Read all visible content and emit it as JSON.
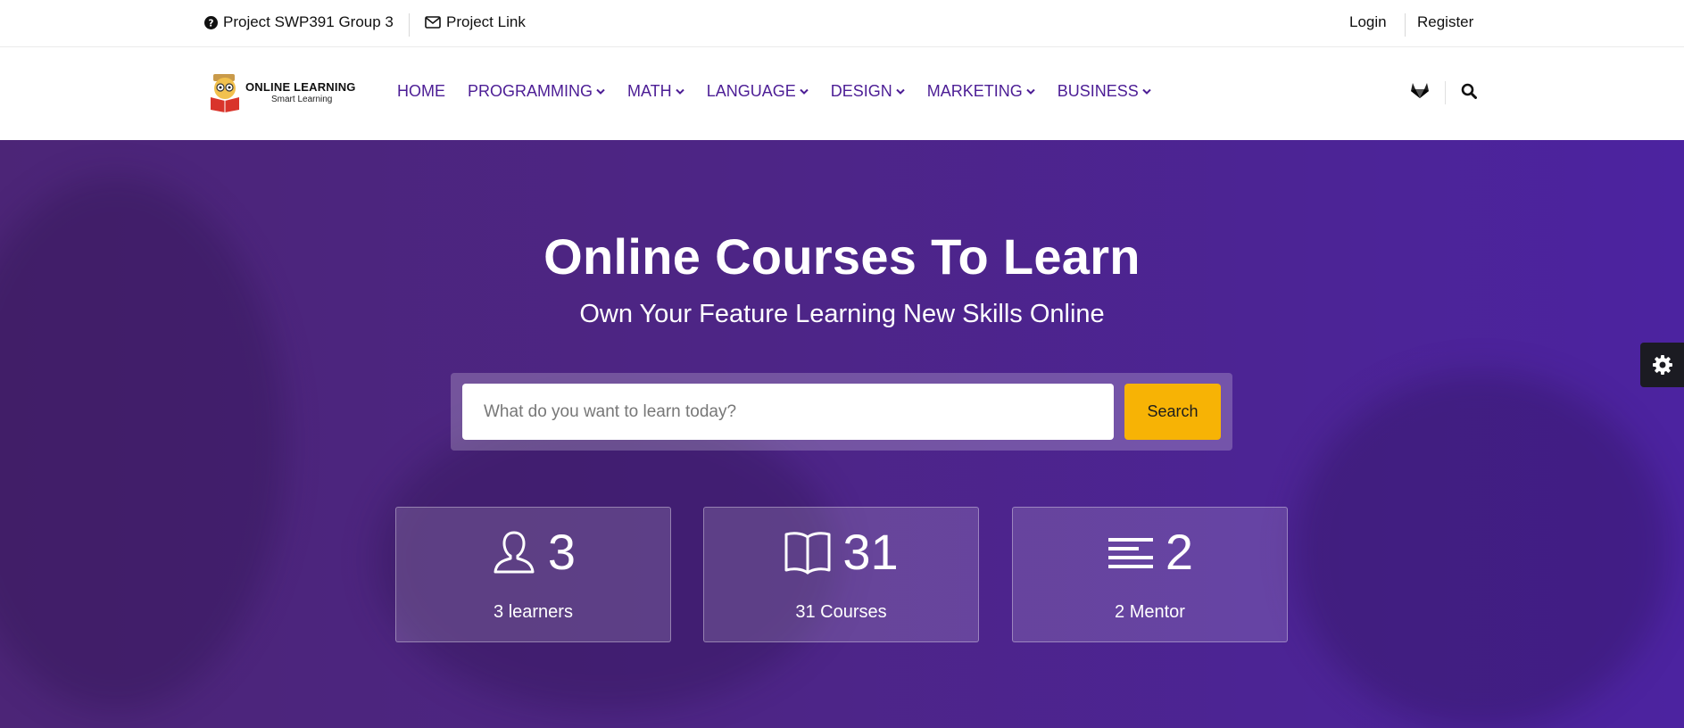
{
  "topbar": {
    "project_label": "Project SWP391 Group 3",
    "project_icon": "question-circle-icon",
    "link_label": "Project Link",
    "link_icon": "envelope-icon",
    "login_label": "Login",
    "register_label": "Register"
  },
  "logo": {
    "title": "ONLINE LEARNING",
    "subtitle": "Smart Learning"
  },
  "nav": {
    "items": [
      {
        "label": "HOME",
        "has_dropdown": false
      },
      {
        "label": "PROGRAMMING",
        "has_dropdown": true
      },
      {
        "label": "MATH",
        "has_dropdown": true
      },
      {
        "label": "LANGUAGE",
        "has_dropdown": true
      },
      {
        "label": "DESIGN",
        "has_dropdown": true
      },
      {
        "label": "MARKETING",
        "has_dropdown": true
      },
      {
        "label": "BUSINESS",
        "has_dropdown": true
      }
    ],
    "right_icons": [
      "gitlab-icon",
      "search-icon"
    ]
  },
  "hero": {
    "title": "Online Courses To Learn",
    "subtitle": "Own Your Feature Learning New Skills Online",
    "search": {
      "placeholder": "What do you want to learn today?",
      "value": "",
      "button_label": "Search"
    },
    "stats": [
      {
        "number": "3",
        "label": "3 learners",
        "icon": "user-icon"
      },
      {
        "number": "31",
        "label": "31 Courses",
        "icon": "book-icon"
      },
      {
        "number": "2",
        "label": "2 Mentor",
        "icon": "lines-icon"
      }
    ]
  },
  "colors": {
    "brand_purple": "#4c1d95",
    "hero_bg": "#4c2586",
    "search_button": "#f7b305",
    "settings_tab": "#1b1b22"
  },
  "settings_tab_icon": "gear-icon"
}
